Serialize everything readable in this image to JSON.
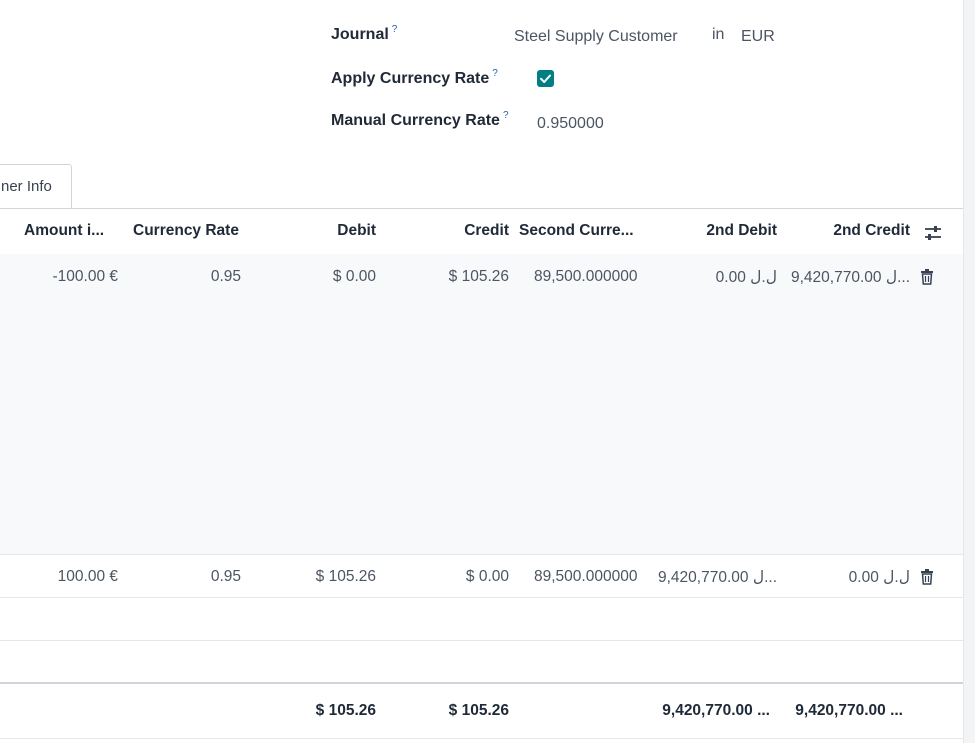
{
  "form": {
    "journal_label": "Journal",
    "journal_value": "Steel Supply Customer",
    "journal_in": "in",
    "journal_currency": "EUR",
    "apply_rate_label": "Apply Currency Rate",
    "apply_rate_checked": true,
    "manual_rate_label": "Manual Currency Rate",
    "manual_rate_value": "0.950000",
    "help_mark": "?"
  },
  "tabs": {
    "other_info": "ner Info"
  },
  "table": {
    "headers": {
      "amount": "Amount i...",
      "currency_rate": "Currency Rate",
      "debit": "Debit",
      "credit": "Credit",
      "second_currency": "Second Curre...",
      "second_debit": "2nd Debit",
      "second_credit": "2nd Credit"
    },
    "rows": [
      {
        "amount": "-100.00 €",
        "currency_rate": "0.95",
        "debit": "$ 0.00",
        "credit": "$ 105.26",
        "second_currency": "89,500.000000",
        "second_debit": "0.00 ل.ل",
        "second_credit": "9,420,770.00 ل..."
      },
      {
        "amount": "100.00 €",
        "currency_rate": "0.95",
        "debit": "$ 105.26",
        "credit": "$ 0.00",
        "second_currency": "89,500.000000",
        "second_debit": "9,420,770.00 ل...",
        "second_credit": "0.00 ل.ل"
      }
    ],
    "totals": {
      "debit": "$ 105.26",
      "credit": "$ 105.26",
      "second_debit": "9,420,770.00 ...",
      "second_credit": "9,420,770.00 ..."
    }
  },
  "colors": {
    "accent": "#017e84"
  }
}
